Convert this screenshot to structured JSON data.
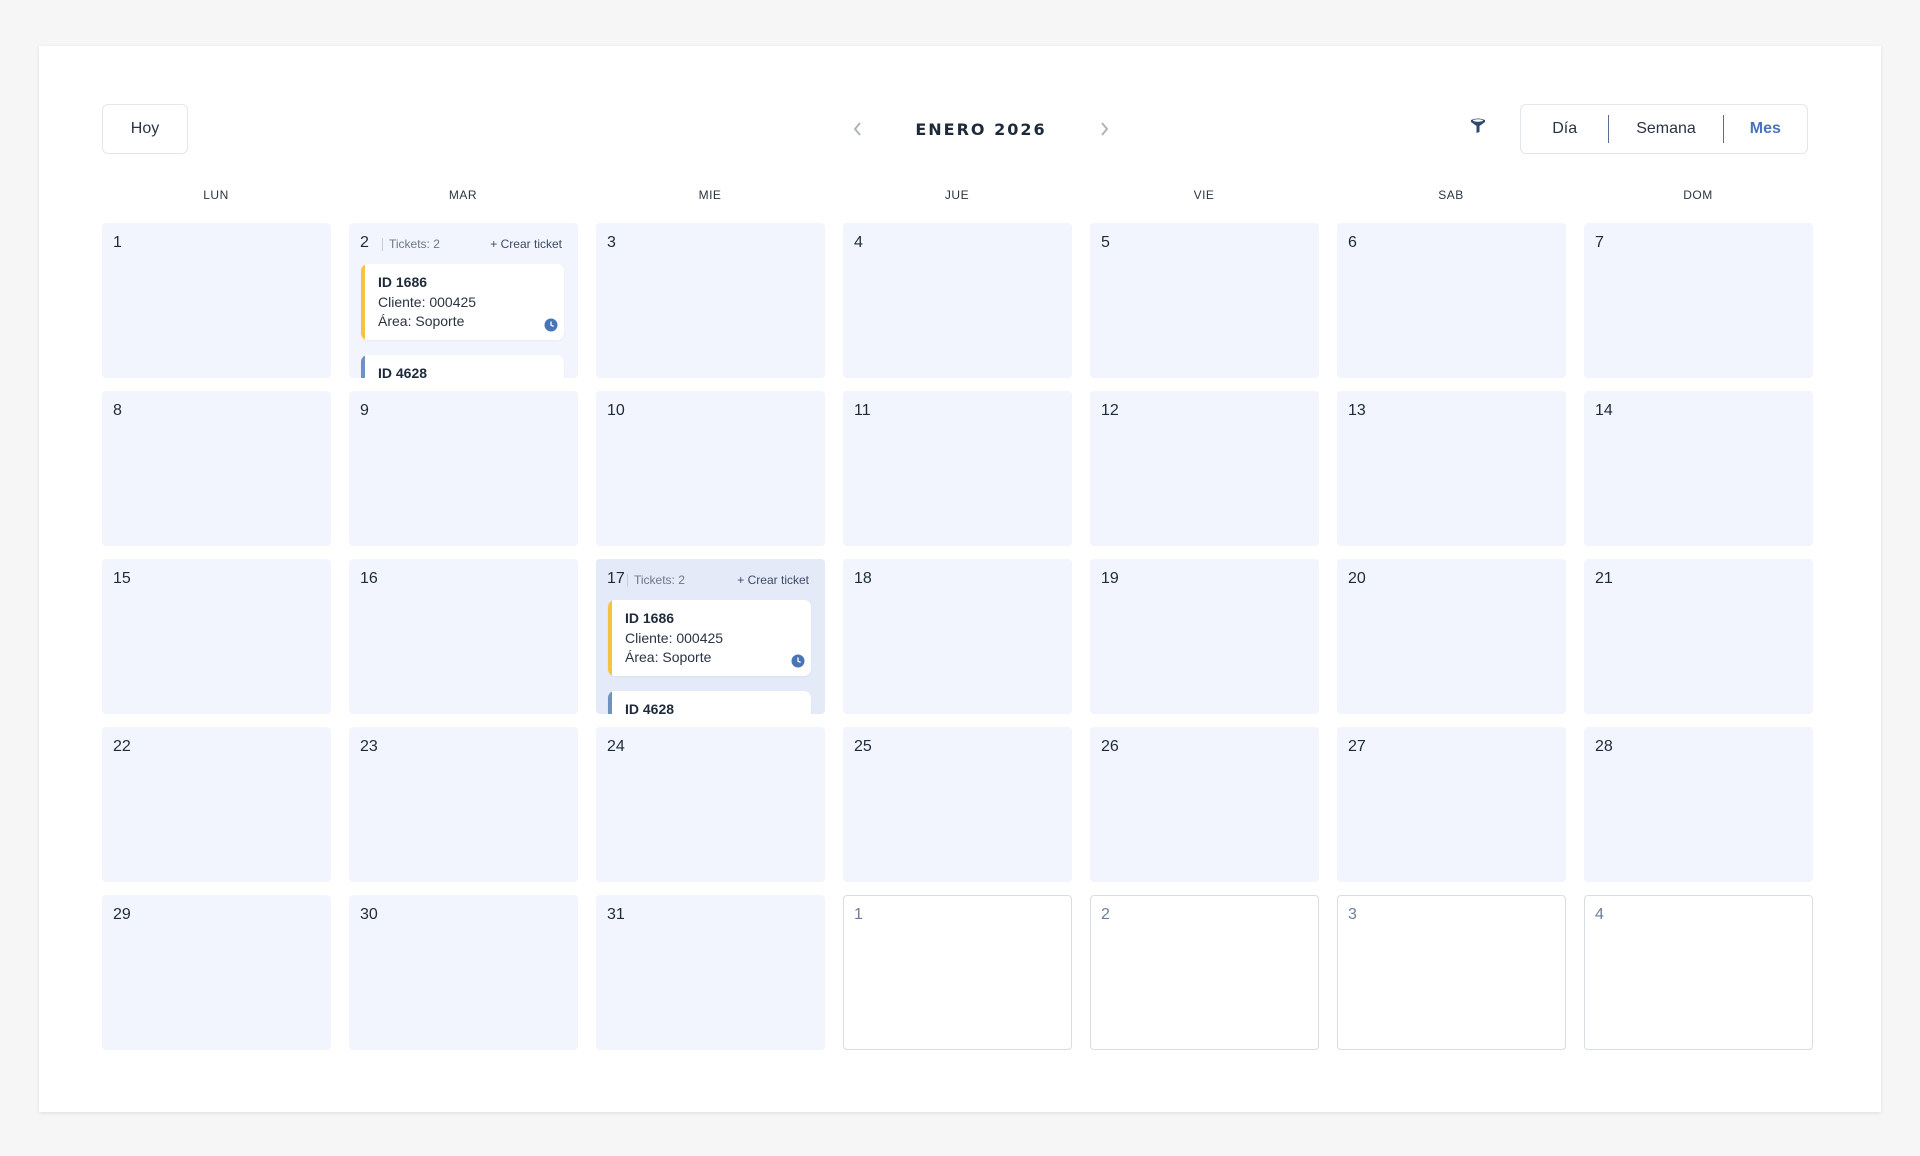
{
  "toolbar": {
    "today_label": "Hoy",
    "month_title": "ENERO 2026",
    "prev_icon": "chevron-left-icon",
    "next_icon": "chevron-right-icon",
    "filter_icon": "funnel-icon",
    "views": [
      {
        "label": "Día",
        "active": false
      },
      {
        "label": "Semana",
        "active": false
      },
      {
        "label": "Mes",
        "active": true
      }
    ]
  },
  "weekdays": [
    "LUN",
    "MAR",
    "MIE",
    "JUE",
    "VIE",
    "SAB",
    "DOM"
  ],
  "colors": {
    "accent": "#4a74b8",
    "day_bg": "#f2f5fd",
    "ticket_bar_yellow": "#f5c242",
    "ticket_bar_blue": "#6f93c0",
    "clock": "#4a74b8"
  },
  "days": [
    {
      "num": "1"
    },
    {
      "num": "2",
      "tickets_label": "Tickets: 2",
      "create_label": "+ Crear ticket",
      "tickets": [
        {
          "id": "ID 1686",
          "client": "Cliente: 000425",
          "area": "Área: Soporte",
          "bar": "yellow"
        },
        {
          "id": "ID 4628",
          "bar": "blue"
        }
      ]
    },
    {
      "num": "3"
    },
    {
      "num": "4"
    },
    {
      "num": "5"
    },
    {
      "num": "6"
    },
    {
      "num": "7"
    },
    {
      "num": "8"
    },
    {
      "num": "9"
    },
    {
      "num": "10"
    },
    {
      "num": "11"
    },
    {
      "num": "12"
    },
    {
      "num": "13"
    },
    {
      "num": "14"
    },
    {
      "num": "15"
    },
    {
      "num": "16"
    },
    {
      "num": "17",
      "highlight": true,
      "tickets_label": "Tickets: 2",
      "create_label": "+ Crear ticket",
      "tickets": [
        {
          "id": "ID 1686",
          "client": "Cliente: 000425",
          "area": "Área: Soporte",
          "bar": "yellow"
        },
        {
          "id": "ID 4628",
          "bar": "blue"
        }
      ]
    },
    {
      "num": "18"
    },
    {
      "num": "19"
    },
    {
      "num": "20"
    },
    {
      "num": "21"
    },
    {
      "num": "22"
    },
    {
      "num": "23"
    },
    {
      "num": "24"
    },
    {
      "num": "25"
    },
    {
      "num": "26"
    },
    {
      "num": "27"
    },
    {
      "num": "28"
    },
    {
      "num": "29"
    },
    {
      "num": "30"
    },
    {
      "num": "31"
    },
    {
      "num": "1",
      "other_month": true
    },
    {
      "num": "2",
      "other_month": true
    },
    {
      "num": "3",
      "other_month": true
    },
    {
      "num": "4",
      "other_month": true
    }
  ]
}
